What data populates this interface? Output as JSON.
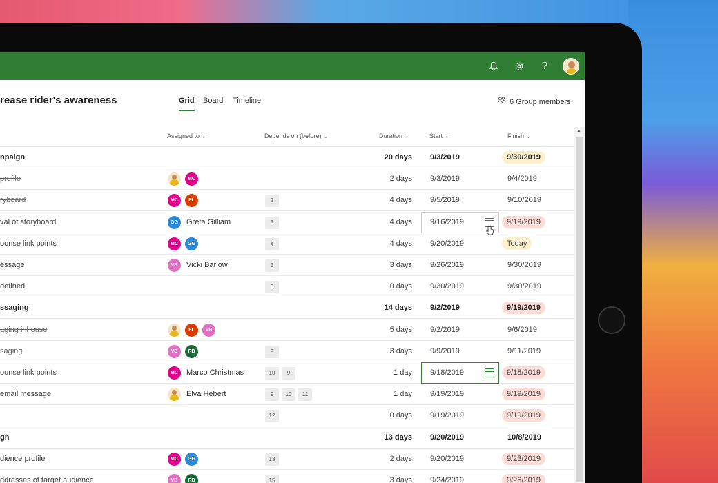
{
  "header": {
    "icons": [
      "bell-icon",
      "gear-icon",
      "help-icon",
      "avatar"
    ],
    "help_glyph": "?"
  },
  "plan": {
    "title": "rease rider's awareness",
    "tabs": [
      {
        "label": "Grid",
        "active": true
      },
      {
        "label": "Board",
        "active": false
      },
      {
        "label": "Timeline",
        "active": false
      }
    ],
    "members": "6 Group members"
  },
  "columns": {
    "assigned": "Assigned to",
    "depends": "Depends on (before)",
    "duration": "Duration",
    "start": "Start",
    "finish": "Finish"
  },
  "rows": [
    {
      "task": "npaign",
      "group": true,
      "duration": "20 days",
      "start": "9/3/2019",
      "finish": "9/30/2019",
      "finish_style": "today"
    },
    {
      "task": "profile",
      "done": true,
      "assignees": [
        "photo",
        "MC"
      ],
      "duration": "2 days",
      "start": "9/3/2019",
      "finish": "9/4/2019"
    },
    {
      "task": "ryboard",
      "done": true,
      "assignees": [
        "MC",
        "FL"
      ],
      "deps": [
        "2"
      ],
      "duration": "4 days",
      "start": "9/5/2019",
      "finish": "9/10/2019"
    },
    {
      "task": "val of storyboard",
      "assignees": [
        "GG"
      ],
      "assignee_name": "Greta Gilliam",
      "deps": [
        "3"
      ],
      "duration": "4 days",
      "start": "9/16/2019",
      "start_state": "editing",
      "finish": "9/19/2019",
      "finish_style": "late"
    },
    {
      "task": "oonse link points",
      "assignees": [
        "MC",
        "GG"
      ],
      "deps": [
        "4"
      ],
      "duration": "4 days",
      "start": "9/20/2019",
      "finish": "Today",
      "finish_style": "today"
    },
    {
      "task": "essage",
      "assignees": [
        "VB"
      ],
      "assignee_name": "Vicki Barlow",
      "deps": [
        "5"
      ],
      "duration": "3 days",
      "start": "9/26/2019",
      "finish": "9/30/2019"
    },
    {
      "task": "defined",
      "deps": [
        "6"
      ],
      "duration": "0 days",
      "start": "9/30/2019",
      "finish": "9/30/2019"
    },
    {
      "task": "ssaging",
      "group": true,
      "duration": "14 days",
      "start": "9/2/2019",
      "finish": "9/19/2019",
      "finish_style": "late"
    },
    {
      "task": "aging inhouse",
      "done": true,
      "assignees": [
        "photo",
        "FL",
        "VB"
      ],
      "duration": "5 days",
      "start": "9/2/2019",
      "finish": "9/6/2019"
    },
    {
      "task": "saging",
      "done": true,
      "assignees": [
        "VB",
        "RB"
      ],
      "deps": [
        "9"
      ],
      "duration": "3 days",
      "start": "9/9/2019",
      "finish": "9/11/2019"
    },
    {
      "task": "oonse link points",
      "assignees": [
        "MC"
      ],
      "assignee_name": "Marco Christmas",
      "deps": [
        "10",
        "9"
      ],
      "duration": "1 day",
      "start": "9/18/2019",
      "start_state": "selected",
      "finish": "9/18/2019",
      "finish_style": "late"
    },
    {
      "task": "email message",
      "assignees": [
        "photo"
      ],
      "assignee_name": "Elva Hebert",
      "deps": [
        "9",
        "10",
        "11"
      ],
      "duration": "1 day",
      "start": "9/19/2019",
      "finish": "9/19/2019",
      "finish_style": "late"
    },
    {
      "task": "",
      "deps": [
        "12"
      ],
      "duration": "0 days",
      "start": "9/19/2019",
      "finish": "9/19/2019",
      "finish_style": "late"
    },
    {
      "task": "gn",
      "group": true,
      "duration": "13 days",
      "start": "9/20/2019",
      "finish": "10/8/2019"
    },
    {
      "task": "dience profile",
      "assignees": [
        "MC",
        "GG"
      ],
      "deps": [
        "13"
      ],
      "duration": "2 days",
      "start": "9/20/2019",
      "finish": "9/23/2019",
      "finish_style": "late"
    },
    {
      "task": "ddresses of target audience",
      "assignees": [
        "VB",
        "RB"
      ],
      "deps": [
        "15"
      ],
      "duration": "3 days",
      "start": "9/24/2019",
      "finish": "9/26/2019",
      "finish_style": "late"
    }
  ],
  "avatar_colors": {
    "MC": "#e3008c",
    "FL": "#da3b01",
    "GG": "#2b88d8",
    "VB": "#e36fc4",
    "RB": "#1e6b3a"
  }
}
